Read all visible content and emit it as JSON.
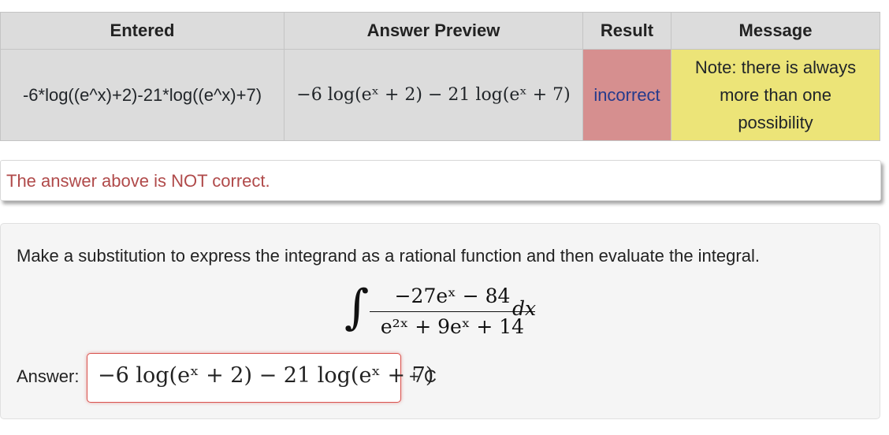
{
  "table": {
    "headers": [
      "Entered",
      "Answer Preview",
      "Result",
      "Message"
    ],
    "row": {
      "entered": "-6*log((e^x)+2)-21*log((e^x)+7)",
      "preview": "−6 log(eˣ + 2) − 21 log(eˣ + 7)",
      "result": "incorrect",
      "message_lines": [
        "Note: there is always",
        "more than one",
        "possibility"
      ]
    }
  },
  "status": {
    "text": "The answer above is NOT correct."
  },
  "problem": {
    "instruction": "Make a substitution to express the integrand as a rational function and then evaluate the integral.",
    "integral": {
      "sign": "∫",
      "numerator": "−27eˣ − 84",
      "denominator": "e²ˣ + 9eˣ + 14",
      "differential": "dx"
    },
    "answer_label": "Answer:",
    "answer_value": "−6 log(eˣ + 2) − 21 log(eˣ + 7)",
    "constant": "+ C"
  },
  "colors": {
    "incorrect_bg": "#d68f8f",
    "message_bg": "#ece478",
    "status_text": "#b04a4a",
    "answer_border": "#d9534f"
  }
}
